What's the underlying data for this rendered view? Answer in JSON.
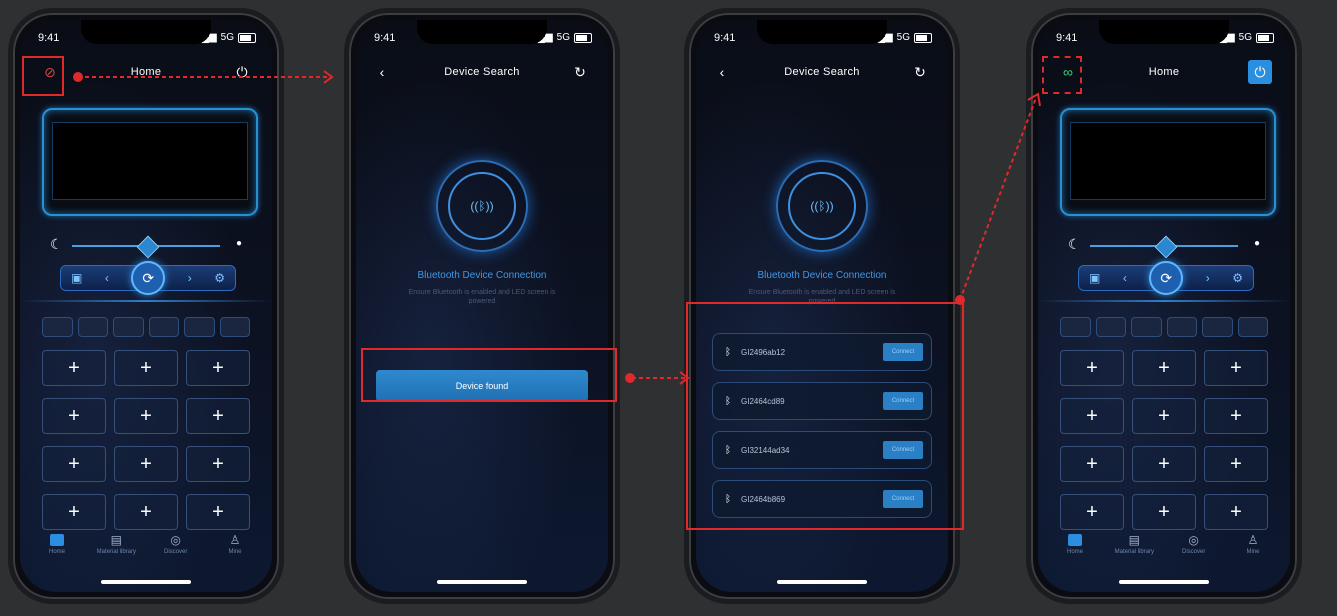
{
  "phones": [
    {
      "status": {
        "time": "9:41",
        "network": "5G"
      },
      "nav": {
        "title": "Home"
      },
      "grid_label": "+",
      "tabs": [
        "Home",
        "Material library",
        "Discover",
        "Mine"
      ]
    },
    {
      "status": {
        "time": "9:41",
        "network": "5G"
      },
      "nav": {
        "title": "Device Search"
      },
      "bt_title": "Bluetooth Device Connection",
      "bt_sub": "Ensure Bluetooth is enabled and LED screen is powered",
      "found_label": "Device found"
    },
    {
      "status": {
        "time": "9:41",
        "network": "5G"
      },
      "nav": {
        "title": "Device Search"
      },
      "bt_title": "Bluetooth Device Connection",
      "bt_sub": "Ensure Bluetooth is enabled and LED screen is powered",
      "devices": [
        {
          "name": "GI2496ab12",
          "action": "Connect"
        },
        {
          "name": "GI2464cd89",
          "action": "Connect"
        },
        {
          "name": "GI32144ad34",
          "action": "Connect"
        },
        {
          "name": "GI2464b869",
          "action": "Connect"
        }
      ]
    },
    {
      "status": {
        "time": "9:41",
        "network": "5G"
      },
      "nav": {
        "title": "Home"
      },
      "grid_label": "+",
      "tabs": [
        "Home",
        "Material library",
        "Discover",
        "Mine"
      ]
    }
  ],
  "icons": {
    "bluetooth": "bluetooth-icon",
    "link": "link-icon",
    "power": "power-icon",
    "back": "back-icon",
    "refresh": "refresh-icon"
  },
  "colors": {
    "accent": "#2a8fe0",
    "annotation": "#e0292b"
  }
}
